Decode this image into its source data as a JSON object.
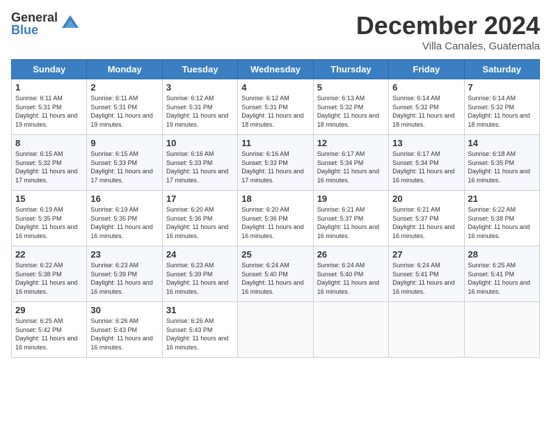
{
  "header": {
    "logo_general": "General",
    "logo_blue": "Blue",
    "month_title": "December 2024",
    "location": "Villa Canales, Guatemala"
  },
  "days_of_week": [
    "Sunday",
    "Monday",
    "Tuesday",
    "Wednesday",
    "Thursday",
    "Friday",
    "Saturday"
  ],
  "weeks": [
    [
      {
        "day": "1",
        "sunrise": "6:11 AM",
        "sunset": "5:31 PM",
        "daylight": "11 hours and 19 minutes."
      },
      {
        "day": "2",
        "sunrise": "6:11 AM",
        "sunset": "5:31 PM",
        "daylight": "11 hours and 19 minutes."
      },
      {
        "day": "3",
        "sunrise": "6:12 AM",
        "sunset": "5:31 PM",
        "daylight": "11 hours and 19 minutes."
      },
      {
        "day": "4",
        "sunrise": "6:12 AM",
        "sunset": "5:31 PM",
        "daylight": "11 hours and 18 minutes."
      },
      {
        "day": "5",
        "sunrise": "6:13 AM",
        "sunset": "5:32 PM",
        "daylight": "11 hours and 18 minutes."
      },
      {
        "day": "6",
        "sunrise": "6:14 AM",
        "sunset": "5:32 PM",
        "daylight": "11 hours and 18 minutes."
      },
      {
        "day": "7",
        "sunrise": "6:14 AM",
        "sunset": "5:32 PM",
        "daylight": "11 hours and 18 minutes."
      }
    ],
    [
      {
        "day": "8",
        "sunrise": "6:15 AM",
        "sunset": "5:32 PM",
        "daylight": "11 hours and 17 minutes."
      },
      {
        "day": "9",
        "sunrise": "6:15 AM",
        "sunset": "5:33 PM",
        "daylight": "11 hours and 17 minutes."
      },
      {
        "day": "10",
        "sunrise": "6:16 AM",
        "sunset": "5:33 PM",
        "daylight": "11 hours and 17 minutes."
      },
      {
        "day": "11",
        "sunrise": "6:16 AM",
        "sunset": "5:33 PM",
        "daylight": "11 hours and 17 minutes."
      },
      {
        "day": "12",
        "sunrise": "6:17 AM",
        "sunset": "5:34 PM",
        "daylight": "11 hours and 16 minutes."
      },
      {
        "day": "13",
        "sunrise": "6:17 AM",
        "sunset": "5:34 PM",
        "daylight": "11 hours and 16 minutes."
      },
      {
        "day": "14",
        "sunrise": "6:18 AM",
        "sunset": "5:35 PM",
        "daylight": "11 hours and 16 minutes."
      }
    ],
    [
      {
        "day": "15",
        "sunrise": "6:19 AM",
        "sunset": "5:35 PM",
        "daylight": "11 hours and 16 minutes."
      },
      {
        "day": "16",
        "sunrise": "6:19 AM",
        "sunset": "5:35 PM",
        "daylight": "11 hours and 16 minutes."
      },
      {
        "day": "17",
        "sunrise": "6:20 AM",
        "sunset": "5:36 PM",
        "daylight": "11 hours and 16 minutes."
      },
      {
        "day": "18",
        "sunrise": "6:20 AM",
        "sunset": "5:36 PM",
        "daylight": "11 hours and 16 minutes."
      },
      {
        "day": "19",
        "sunrise": "6:21 AM",
        "sunset": "5:37 PM",
        "daylight": "11 hours and 16 minutes."
      },
      {
        "day": "20",
        "sunrise": "6:21 AM",
        "sunset": "5:37 PM",
        "daylight": "11 hours and 16 minutes."
      },
      {
        "day": "21",
        "sunrise": "6:22 AM",
        "sunset": "5:38 PM",
        "daylight": "11 hours and 16 minutes."
      }
    ],
    [
      {
        "day": "22",
        "sunrise": "6:22 AM",
        "sunset": "5:38 PM",
        "daylight": "11 hours and 16 minutes."
      },
      {
        "day": "23",
        "sunrise": "6:23 AM",
        "sunset": "5:39 PM",
        "daylight": "11 hours and 16 minutes."
      },
      {
        "day": "24",
        "sunrise": "6:23 AM",
        "sunset": "5:39 PM",
        "daylight": "11 hours and 16 minutes."
      },
      {
        "day": "25",
        "sunrise": "6:24 AM",
        "sunset": "5:40 PM",
        "daylight": "11 hours and 16 minutes."
      },
      {
        "day": "26",
        "sunrise": "6:24 AM",
        "sunset": "5:40 PM",
        "daylight": "11 hours and 16 minutes."
      },
      {
        "day": "27",
        "sunrise": "6:24 AM",
        "sunset": "5:41 PM",
        "daylight": "11 hours and 16 minutes."
      },
      {
        "day": "28",
        "sunrise": "6:25 AM",
        "sunset": "5:41 PM",
        "daylight": "11 hours and 16 minutes."
      }
    ],
    [
      {
        "day": "29",
        "sunrise": "6:25 AM",
        "sunset": "5:42 PM",
        "daylight": "11 hours and 16 minutes."
      },
      {
        "day": "30",
        "sunrise": "6:26 AM",
        "sunset": "5:43 PM",
        "daylight": "11 hours and 16 minutes."
      },
      {
        "day": "31",
        "sunrise": "6:26 AM",
        "sunset": "5:43 PM",
        "daylight": "11 hours and 16 minutes."
      },
      null,
      null,
      null,
      null
    ]
  ]
}
